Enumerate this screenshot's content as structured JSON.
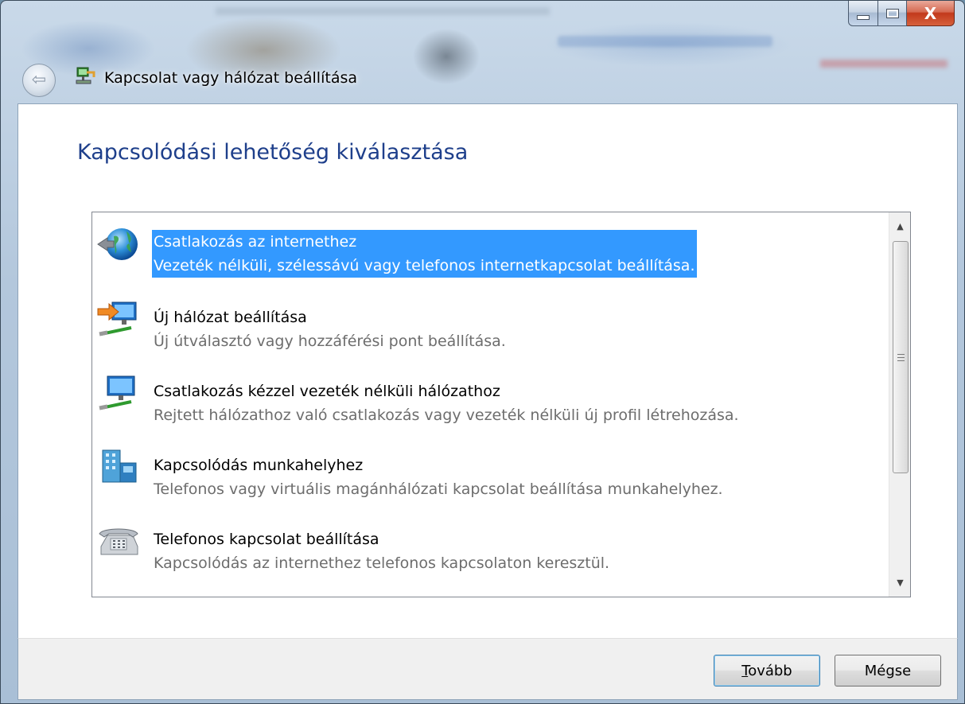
{
  "window": {
    "title": "Kapcsolat vagy hálózat beállítása",
    "caption_buttons": {
      "minimize_icon": "minimize-icon",
      "maximize_icon": "maximize-icon",
      "close_label": "X"
    }
  },
  "header": {
    "back_icon": "back-arrow-icon",
    "back_glyph": "⇦"
  },
  "main": {
    "heading": "Kapcsolódási lehetőség kiválasztása",
    "options": [
      {
        "title": "Csatlakozás az internethez",
        "description": "Vezeték nélküli, szélessávú vagy telefonos internetkapcsolat beállítása.",
        "icon": "globe-icon",
        "selected": true
      },
      {
        "title": "Új hálózat beállítása",
        "description": "Új útválasztó vagy hozzáférési pont beállítása.",
        "icon": "new-network-icon",
        "selected": false
      },
      {
        "title": "Csatlakozás kézzel vezeték nélküli hálózathoz",
        "description": "Rejtett hálózathoz való csatlakozás vagy vezeték nélküli új profil létrehozása.",
        "icon": "wireless-network-icon",
        "selected": false
      },
      {
        "title": "Kapcsolódás munkahelyhez",
        "description": "Telefonos vagy virtuális magánhálózati kapcsolat beállítása munkahelyhez.",
        "icon": "workplace-building-icon",
        "selected": false
      },
      {
        "title": "Telefonos kapcsolat beállítása",
        "description": "Kapcsolódás az internethez telefonos kapcsolaton keresztül.",
        "icon": "telephone-icon",
        "selected": false
      }
    ]
  },
  "footer": {
    "next_label": "Tovább",
    "cancel_label": "Mégse"
  },
  "colors": {
    "heading": "#1e3f8b",
    "selection": "#3399ff",
    "description": "#6d6d6d"
  }
}
